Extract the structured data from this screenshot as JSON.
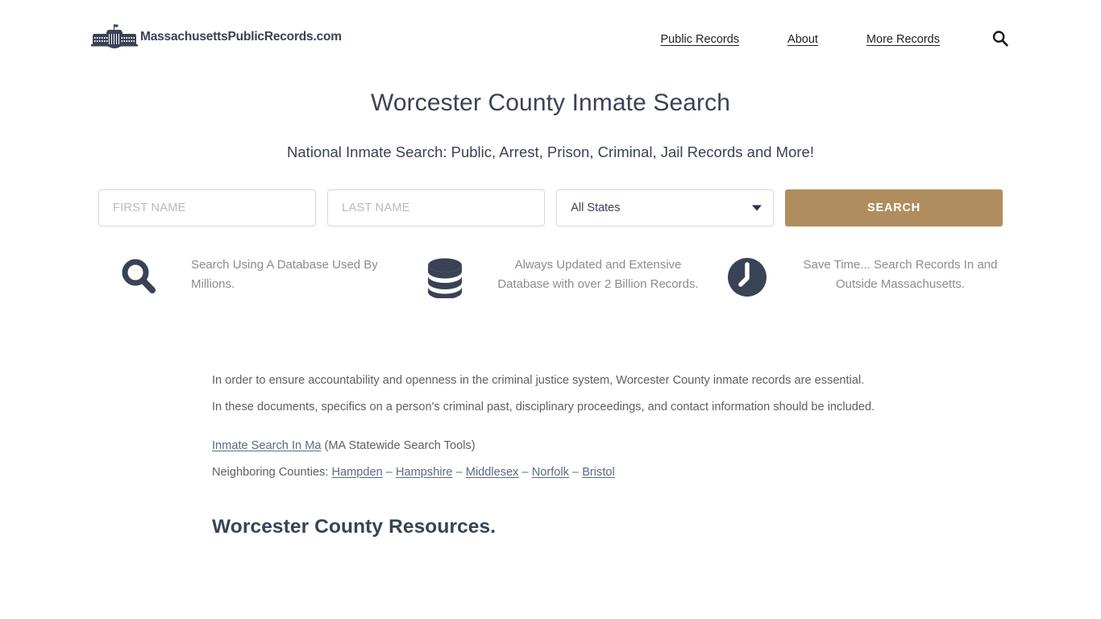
{
  "header": {
    "logo_text": "MassachusettsPublicRecords.com",
    "logo_icon": "whitehouse-building-icon",
    "nav": [
      {
        "label": "Public Records",
        "name": "nav-link-public-records"
      },
      {
        "label": "About",
        "name": "nav-link-about"
      },
      {
        "label": "More Records",
        "name": "nav-link-more-records"
      }
    ],
    "search_icon": "search-icon"
  },
  "hero": {
    "title": "Worcester County Inmate Search",
    "subtitle": "National Inmate Search: Public, Arrest, Prison, Criminal, Jail Records and More!"
  },
  "search_form": {
    "first_name_placeholder": "FIRST NAME",
    "first_name_value": "",
    "last_name_placeholder": "LAST NAME",
    "last_name_value": "",
    "state_selected": "All States",
    "state_options": [
      "All States"
    ],
    "submit_label": "SEARCH",
    "submit_color": "#b08d5f"
  },
  "features": [
    {
      "icon": "magnifier-icon",
      "text": "Search Using A Database Used By Millions."
    },
    {
      "icon": "database-icon",
      "text": "Always Updated and Extensive Database with over 2 Billion Records."
    },
    {
      "icon": "clock-icon",
      "text": "Save Time... Search Records In and Outside Massachusetts."
    }
  ],
  "content": {
    "paragraph_1": "In order to ensure accountability and openness in the criminal justice system, Worcester County inmate records are essential.",
    "paragraph_2": "In these documents, specifics on a person's criminal past, disciplinary proceedings, and contact information should be included.",
    "statewide_link": "Inmate Search In Ma",
    "statewide_note": " (MA Statewide Search Tools)",
    "neighboring_label": "Neighboring Counties: ",
    "neighboring_counties": [
      "Hampden",
      "Hampshire",
      "Middlesex",
      "Norfolk",
      "Bristol"
    ],
    "separator": " – ",
    "resources_heading": "Worcester County Resources."
  },
  "theme": {
    "heading_color": "#3a4256",
    "body_text_color": "#5f5f5f",
    "link_color": "#5b6b84",
    "accent_color": "#b08d5f",
    "icon_color": "#3a4256"
  }
}
